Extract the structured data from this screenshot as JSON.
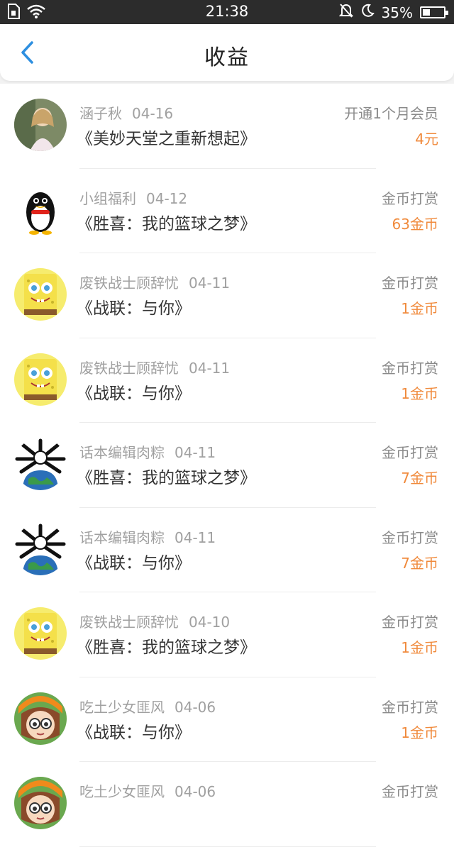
{
  "status_bar": {
    "time": "21:38",
    "battery": "35%",
    "icons": [
      "sim-icon",
      "wifi-icon",
      "mute-bell-icon",
      "moon-icon",
      "battery-icon"
    ]
  },
  "header": {
    "title": "收益",
    "back_icon": "chevron-left-icon"
  },
  "colors": {
    "accent_orange": "#f08a3c",
    "back_blue": "#2d8fe0"
  },
  "records": [
    {
      "user": "涵子秋",
      "date": "04-16",
      "book": "《美妙天堂之重新想起》",
      "type": "开通1个月会员",
      "amount": "4元",
      "avatar": "portrait-girl"
    },
    {
      "user": "小组福利",
      "date": "04-12",
      "book": "《胜喜：我的篮球之梦》",
      "type": "金币打赏",
      "amount": "63金币",
      "avatar": "penguin"
    },
    {
      "user": "废铁战士顾辞忧",
      "date": "04-11",
      "book": "《战联：与你》",
      "type": "金币打赏",
      "amount": "1金币",
      "avatar": "sponge"
    },
    {
      "user": "废铁战士顾辞忧",
      "date": "04-11",
      "book": "《战联：与你》",
      "type": "金币打赏",
      "amount": "1金币",
      "avatar": "sponge"
    },
    {
      "user": "话本编辑肉粽",
      "date": "04-11",
      "book": "《胜喜：我的篮球之梦》",
      "type": "金币打赏",
      "amount": "7金币",
      "avatar": "globe"
    },
    {
      "user": "话本编辑肉粽",
      "date": "04-11",
      "book": "《战联：与你》",
      "type": "金币打赏",
      "amount": "7金币",
      "avatar": "globe"
    },
    {
      "user": "废铁战士顾辞忧",
      "date": "04-10",
      "book": "《胜喜：我的篮球之梦》",
      "type": "金币打赏",
      "amount": "1金币",
      "avatar": "sponge"
    },
    {
      "user": "吃土少女匪风",
      "date": "04-06",
      "book": "《战联：与你》",
      "type": "金币打赏",
      "amount": "1金币",
      "avatar": "anime-girl"
    },
    {
      "user": "吃土少女匪风",
      "date": "04-06",
      "book": "",
      "type": "金币打赏",
      "amount": "",
      "avatar": "anime-girl"
    }
  ]
}
